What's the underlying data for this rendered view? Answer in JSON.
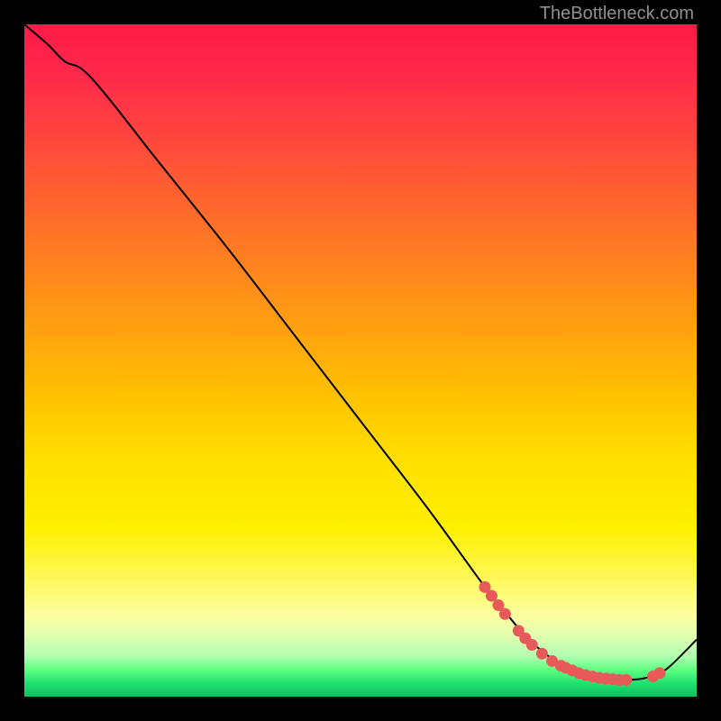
{
  "watermark": "TheBottleneck.com",
  "chart_data": {
    "type": "line",
    "title": "",
    "xlabel": "",
    "ylabel": "",
    "xlim": [
      0,
      100
    ],
    "ylim": [
      0,
      100
    ],
    "series": [
      {
        "name": "curve",
        "x": [
          0,
          3.5,
          6,
          10,
          20,
          30,
          40,
          50,
          60,
          68,
          72,
          75,
          78,
          80,
          82,
          84,
          86,
          88,
          90,
          92,
          94,
          96,
          100
        ],
        "y": [
          100,
          97,
          94.5,
          92,
          79.5,
          67,
          54,
          41,
          28,
          17,
          12,
          8.5,
          6,
          4.5,
          3.7,
          3.1,
          2.7,
          2.5,
          2.5,
          2.7,
          3.3,
          4.5,
          8.5
        ]
      }
    ],
    "markers": [
      {
        "x": 68.5,
        "y": 16.3
      },
      {
        "x": 69.5,
        "y": 15.0
      },
      {
        "x": 70.5,
        "y": 13.6
      },
      {
        "x": 71.5,
        "y": 12.3
      },
      {
        "x": 73.5,
        "y": 9.8
      },
      {
        "x": 74.5,
        "y": 8.7
      },
      {
        "x": 75.5,
        "y": 7.7
      },
      {
        "x": 77.0,
        "y": 6.4
      },
      {
        "x": 78.5,
        "y": 5.3
      },
      {
        "x": 79.8,
        "y": 4.6
      },
      {
        "x": 80.5,
        "y": 4.3
      },
      {
        "x": 81.5,
        "y": 3.9
      },
      {
        "x": 82.5,
        "y": 3.5
      },
      {
        "x": 83.5,
        "y": 3.2
      },
      {
        "x": 84.5,
        "y": 3.0
      },
      {
        "x": 85.5,
        "y": 2.8
      },
      {
        "x": 86.5,
        "y": 2.7
      },
      {
        "x": 87.5,
        "y": 2.6
      },
      {
        "x": 88.5,
        "y": 2.5
      },
      {
        "x": 89.5,
        "y": 2.5
      },
      {
        "x": 93.5,
        "y": 3.0
      },
      {
        "x": 94.5,
        "y": 3.5
      }
    ],
    "colors": {
      "curve": "#000000",
      "marker": "#e85a5a"
    }
  }
}
